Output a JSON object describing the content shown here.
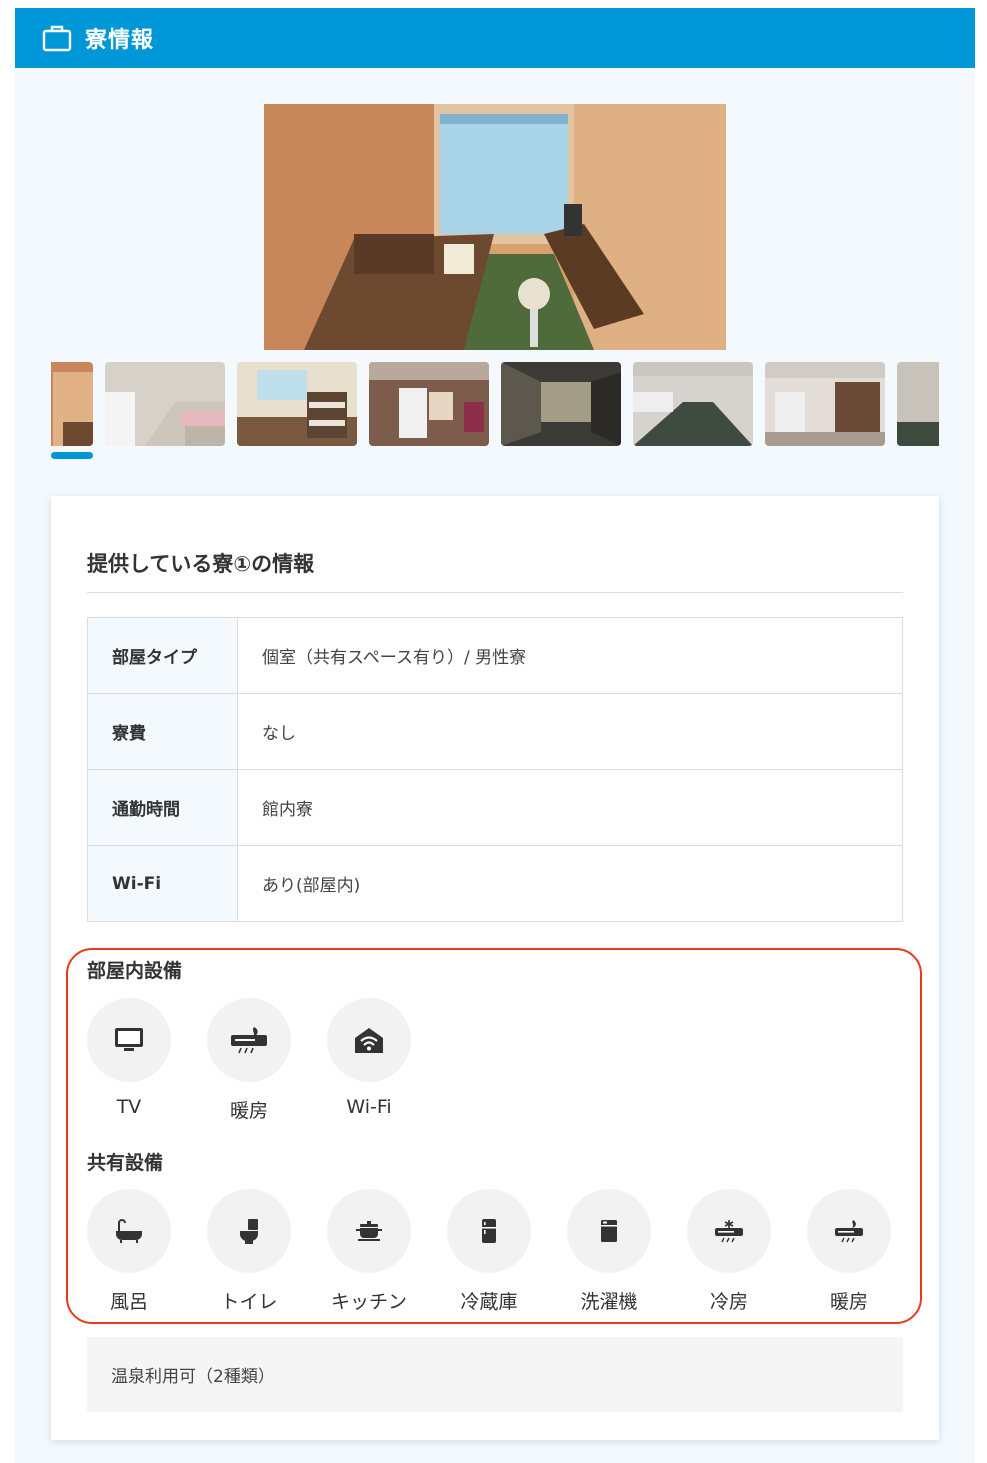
{
  "header": {
    "title": "寮情報",
    "icon": "briefcase-icon"
  },
  "gallery": {
    "main_photo": "dormitory-room-photo",
    "thumbnails": [
      "room-thumb",
      "washroom-thumb",
      "shared-room-thumb",
      "room-with-fridge-thumb",
      "hallway-thumb",
      "corridor-thumb",
      "toilet-thumb",
      "partial-thumb"
    ]
  },
  "card": {
    "title": "提供している寮①の情報",
    "rows": [
      {
        "label": "部屋タイプ",
        "value": "個室（共有スペース有り）/ 男性寮"
      },
      {
        "label": "寮費",
        "value": "なし"
      },
      {
        "label": "通勤時間",
        "value": "館内寮"
      },
      {
        "label": "Wi-Fi",
        "value": "あり(部屋内)"
      }
    ],
    "room_facilities": {
      "title": "部屋内設備",
      "items": [
        {
          "label": "TV",
          "icon": "tv-icon"
        },
        {
          "label": "暖房",
          "icon": "heater-icon"
        },
        {
          "label": "Wi-Fi",
          "icon": "wifi-icon"
        }
      ]
    },
    "shared_facilities": {
      "title": "共有設備",
      "items": [
        {
          "label": "風呂",
          "icon": "bathtub-icon"
        },
        {
          "label": "トイレ",
          "icon": "toilet-icon"
        },
        {
          "label": "キッチン",
          "icon": "kitchen-pot-icon"
        },
        {
          "label": "冷蔵庫",
          "icon": "fridge-icon"
        },
        {
          "label": "洗濯機",
          "icon": "washing-machine-icon"
        },
        {
          "label": "冷房",
          "icon": "air-conditioner-icon"
        },
        {
          "label": "暖房",
          "icon": "heater-icon"
        }
      ]
    },
    "note": "温泉利用可（2種類）"
  },
  "colors": {
    "accent": "#0097d8",
    "highlight": "#e8391d",
    "label_bg": "#f3f9fd"
  }
}
